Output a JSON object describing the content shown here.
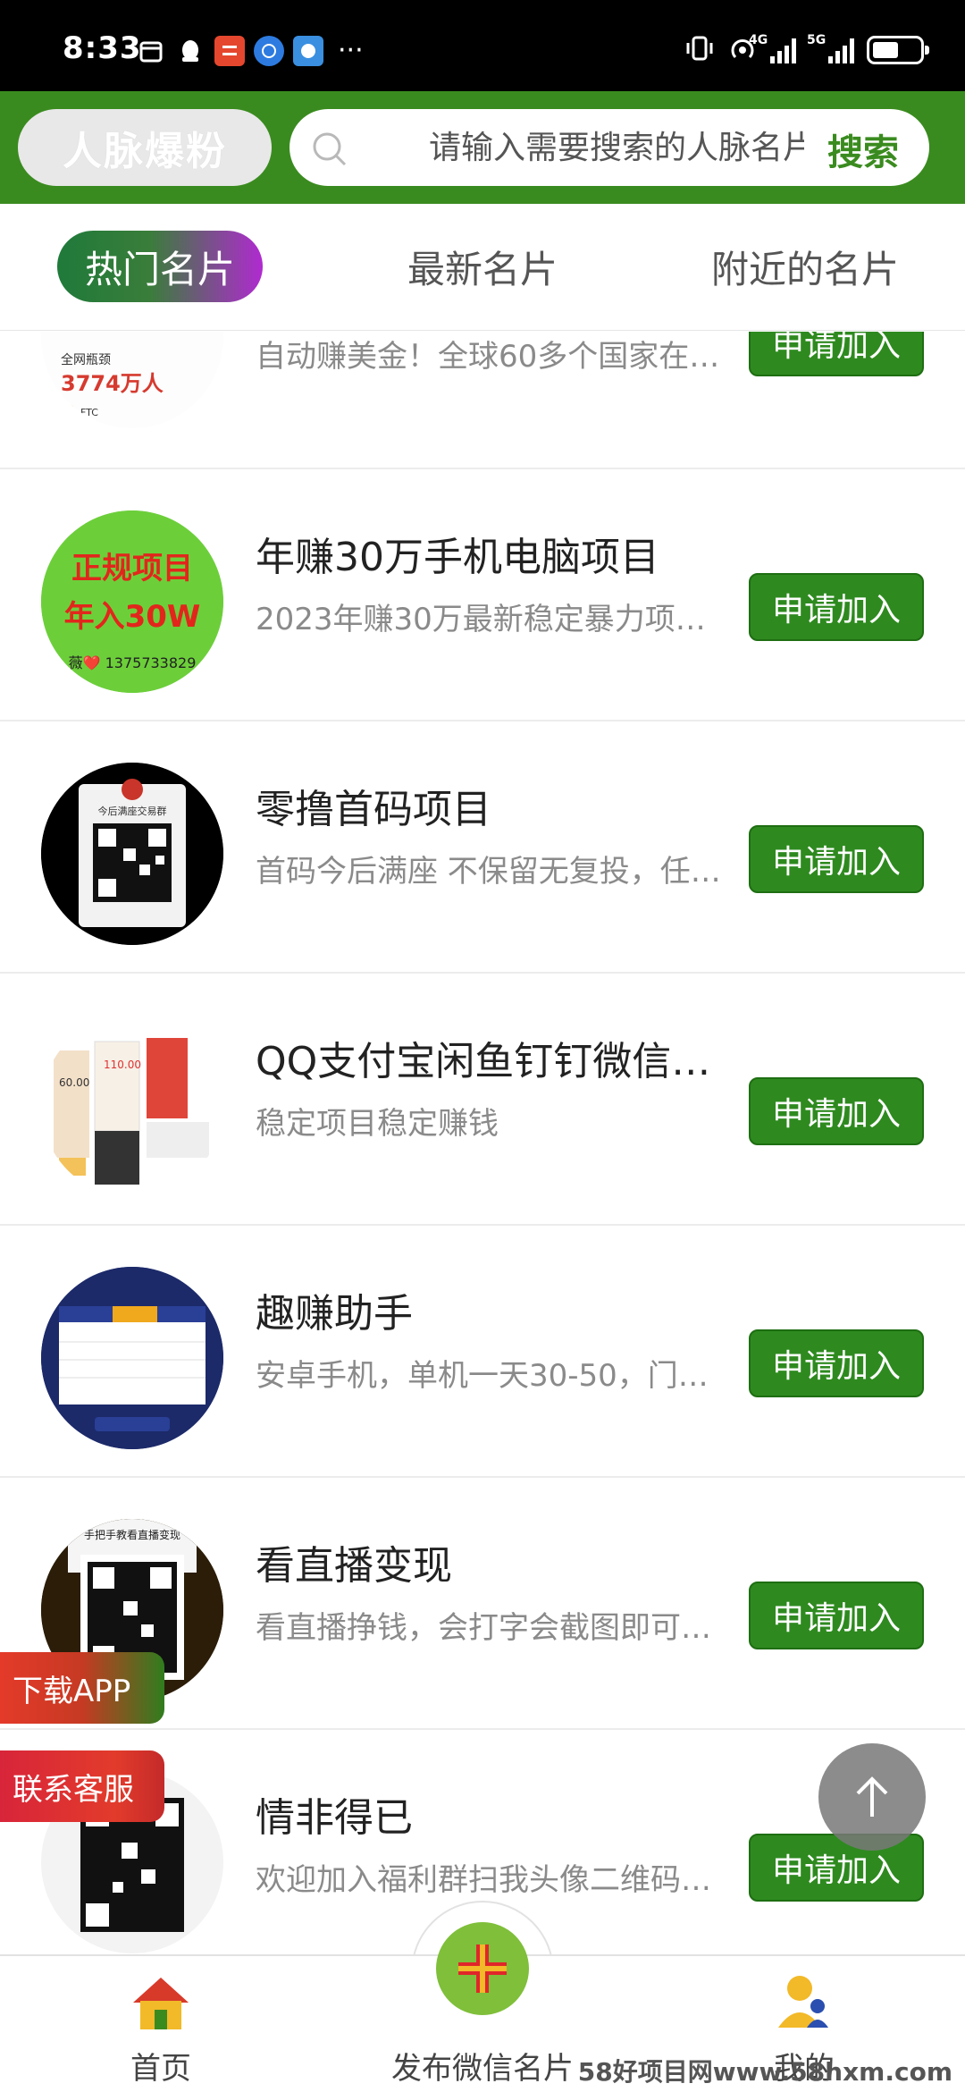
{
  "status_bar": {
    "time": "8:33",
    "net1": "4G",
    "net2": "5G"
  },
  "header": {
    "app_title": "人脉爆粉",
    "search_placeholder": "请输入需要搜索的人脉名片",
    "search_button": "搜索"
  },
  "tabs": [
    {
      "label": "热门名片",
      "active": true
    },
    {
      "label": "最新名片",
      "active": false
    },
    {
      "label": "附近的名片",
      "active": false
    }
  ],
  "cards": [
    {
      "title": "",
      "desc": "自动赚美金！全球60多个国家在…",
      "button": "申请加入",
      "thumb": "ftc",
      "thumb_text": "3774万人"
    },
    {
      "title": "年赚30万手机电脑项目",
      "desc": "2023年赚30万最新稳定暴力项…",
      "button": "申请加入",
      "thumb": "green",
      "thumb_text": "正规项目",
      "thumb_text2": "年入30W"
    },
    {
      "title": "零撸首码项目",
      "desc": "首码今后满座 不保留无复投，任…",
      "button": "申请加入",
      "thumb": "qr-black",
      "thumb_text": "今后满座交易群"
    },
    {
      "title": "QQ支付宝闲鱼钉钉微信…",
      "desc": "稳定项目稳定赚钱",
      "button": "申请加入",
      "thumb": "collage"
    },
    {
      "title": "趣赚助手",
      "desc": "安卓手机，单机一天30-50，门…",
      "button": "申请加入",
      "thumb": "table-blue"
    },
    {
      "title": "看直播变现",
      "desc": "看直播挣钱，会打字会截图即可…",
      "button": "申请加入",
      "thumb": "qr-gold",
      "thumb_text": "手把手教看直播变现"
    },
    {
      "title": "情非得已",
      "desc": "欢迎加入福利群扫我头像二维码…",
      "button": "申请加入",
      "thumb": "qr-white"
    }
  ],
  "floating": {
    "download": "下载APP",
    "service": "联系客服"
  },
  "bottom_nav": {
    "home": "首页",
    "publish": "发布微信名片",
    "me": "我的"
  },
  "watermark": "58好项目网www.58hxm.com",
  "colors": {
    "brand_green": "#3a8b1f",
    "button_green": "#2e8a1f",
    "tab_gradient_end": "#b02ad0"
  }
}
